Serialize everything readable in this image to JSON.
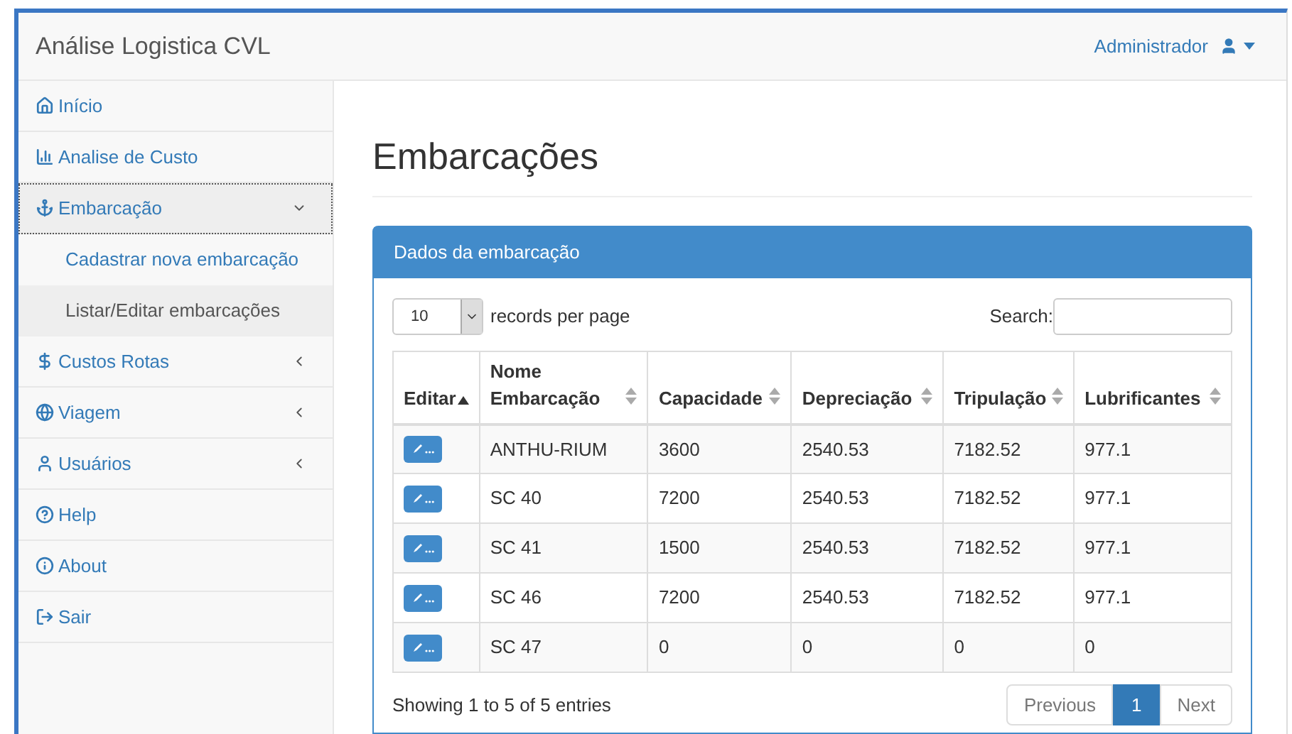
{
  "navbar": {
    "brand": "Análise Logistica CVL",
    "user": "Administrador"
  },
  "sidebar": {
    "items": [
      {
        "label": "Início"
      },
      {
        "label": "Analise de Custo"
      },
      {
        "label": "Embarcação",
        "expanded": true,
        "children": [
          {
            "label": "Cadastrar nova embarcação",
            "selected": false
          },
          {
            "label": "Listar/Editar embarcações",
            "selected": true
          }
        ]
      },
      {
        "label": "Custos Rotas",
        "expanded": false
      },
      {
        "label": "Viagem",
        "expanded": false
      },
      {
        "label": "Usuários",
        "expanded": false
      },
      {
        "label": "Help"
      },
      {
        "label": "About"
      },
      {
        "label": "Sair"
      }
    ]
  },
  "page": {
    "title": "Embarcações"
  },
  "panel": {
    "title": "Dados da embarcação",
    "length": {
      "value": "10",
      "label": "records per page"
    },
    "search": {
      "label": "Search:"
    },
    "table": {
      "columns": [
        {
          "label": "Editar",
          "sorted": true
        },
        {
          "label": "Nome Embarcação",
          "sorted": false
        },
        {
          "label": "Capacidade",
          "sorted": false
        },
        {
          "label": "Depreciação",
          "sorted": false
        },
        {
          "label": "Tripulação",
          "sorted": false
        },
        {
          "label": "Lubrificantes",
          "sorted": false
        }
      ],
      "rows": [
        [
          "",
          "ANTHU-RIUM",
          "3600",
          "2540.53",
          "7182.52",
          "977.1"
        ],
        [
          "",
          "SC 40",
          "7200",
          "2540.53",
          "7182.52",
          "977.1"
        ],
        [
          "",
          "SC 41",
          "1500",
          "2540.53",
          "7182.52",
          "977.1"
        ],
        [
          "",
          "SC 46",
          "7200",
          "2540.53",
          "7182.52",
          "977.1"
        ],
        [
          "",
          "SC 47",
          "0",
          "0",
          "0",
          "0"
        ]
      ]
    },
    "info": "Showing 1 to 5 of 5 entries",
    "pagination": {
      "previous": "Previous",
      "pages": [
        {
          "label": "1",
          "selected": true
        }
      ],
      "next": "Next"
    }
  }
}
